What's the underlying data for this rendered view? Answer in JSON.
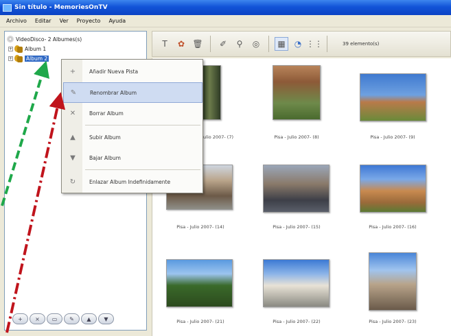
{
  "window": {
    "title": "Sin título - MemoriesOnTV"
  },
  "menubar": [
    "Archivo",
    "Editar",
    "Ver",
    "Proyecto",
    "Ayuda"
  ],
  "tree": {
    "root": "VideoDisco- 2 Albumes(s)",
    "albums": [
      "Album 1",
      "Album 2"
    ]
  },
  "toolbar": {
    "icons": [
      "text-icon",
      "effects-icon",
      "delete-icon",
      "edit-icon",
      "tools-icon",
      "disc-icon",
      "view-large-icon",
      "view-details-icon",
      "view-grid-icon"
    ],
    "count_label": "39 elemento(s)"
  },
  "gallery": {
    "photos": [
      {
        "caption": "Pisa - Julio 2007- (7)"
      },
      {
        "caption": "Pisa - Julio 2007- (8)"
      },
      {
        "caption": "Pisa - Julio 2007- (9)"
      },
      {
        "caption": "Pisa - Julio 2007- (14)"
      },
      {
        "caption": "Pisa - Julio 2007- (15)"
      },
      {
        "caption": "Pisa - Julio 2007- (16)"
      },
      {
        "caption": "Pisa - Julio 2007- (21)"
      },
      {
        "caption": "Pisa - Julio 2007- (22)"
      },
      {
        "caption": "Pisa - Julio 2007- (23)"
      }
    ]
  },
  "context_menu": {
    "items": [
      {
        "label": "Añadir Nueva Pista",
        "icon": "plus-icon"
      },
      {
        "label": "Renombrar Album",
        "icon": "pencil-icon",
        "highlighted": true
      },
      {
        "label": "Borrar Album",
        "icon": "x-icon"
      },
      {
        "label": "Subir Album",
        "icon": "arrow-up-icon"
      },
      {
        "label": "Bajar Album",
        "icon": "arrow-down-icon"
      },
      {
        "label": "Enlazar Album Indefinidamente",
        "icon": "loop-icon"
      }
    ]
  },
  "colors": {
    "titlebar": "#1254d8",
    "selection": "#316ac5",
    "menu_highlight": "#cfdcf2",
    "arrow_green": "#1fa84a",
    "arrow_red": "#c0141c"
  }
}
